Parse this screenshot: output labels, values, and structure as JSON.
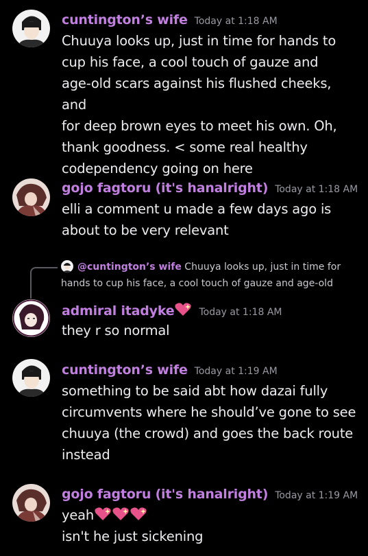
{
  "messages": [
    {
      "author": "cuntington’s wife",
      "time": "Today at 1:18 AM",
      "lines": [
        "Chuuya looks up, just in time for hands to",
        "cup his face, a cool touch of gauze and",
        "age-old scars against his flushed cheeks, and",
        "for deep brown eyes to meet his own. Oh,",
        "thank goodness. < some real healthy",
        "codependency going on here"
      ]
    },
    {
      "author": "gojo fagtoru (it's hanalright)",
      "time": "Today at 1:18 AM",
      "lines": [
        "elli a comment u made a few days ago is",
        "about to be very relevant"
      ]
    },
    {
      "reply": {
        "mention": "@cuntington’s wife",
        "snippet_line1": "Chuuya looks up, just in time for",
        "snippet_line2": "hands to cup his face, a cool touch of gauze and age-old"
      },
      "author": "admiral itadyke",
      "time": "Today at 1:18 AM",
      "lines": [
        "they r so normal"
      ]
    },
    {
      "author": "cuntington’s wife",
      "time": "Today at 1:19 AM",
      "lines": [
        "something to be said abt how dazai fully",
        "circumvents where he should’ve gone to see",
        "chuuya (the crowd) and goes the back route",
        "instead"
      ]
    },
    {
      "author": "gojo fagtoru (it's hanalright)",
      "time": "Today at 1:19 AM",
      "lines": [
        "yeah",
        "isn't he just sickening"
      ]
    }
  ],
  "colors": {
    "background": "#000000",
    "username": "#c17fe0",
    "timestamp": "#9a9aa3",
    "text": "#ededf0",
    "heart": "#e8528a"
  },
  "icons": {
    "sparkle_heart": "sparkling-heart-emoji"
  }
}
